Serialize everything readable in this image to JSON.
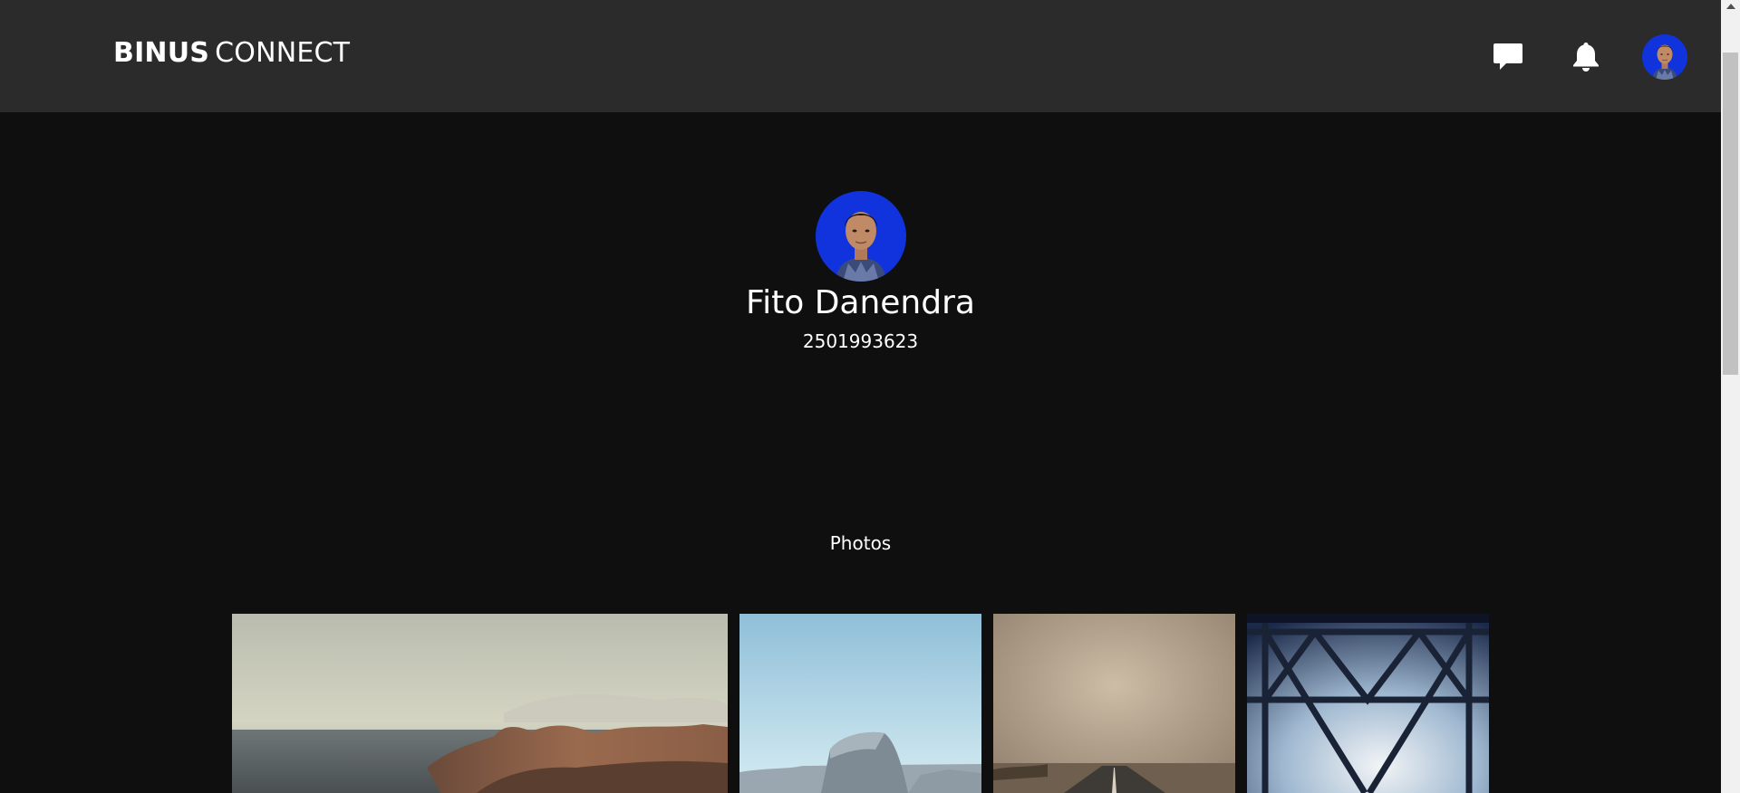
{
  "header": {
    "logo_bold": "BINUS",
    "logo_light": "CONNECT",
    "icons": [
      "chat-icon",
      "bell-icon",
      "avatar"
    ]
  },
  "profile": {
    "name": "Fito Danendra",
    "student_id": "2501993623"
  },
  "photos_section": {
    "title": "Photos",
    "items": [
      "coastline-photo",
      "mountain-dome-photo",
      "desert-road-photo",
      "bridge-photo"
    ]
  },
  "colors": {
    "topbar": "#2b2b2b",
    "background": "#0f0f0f",
    "avatar_bg": "#1133dd",
    "text": "#ffffff"
  }
}
